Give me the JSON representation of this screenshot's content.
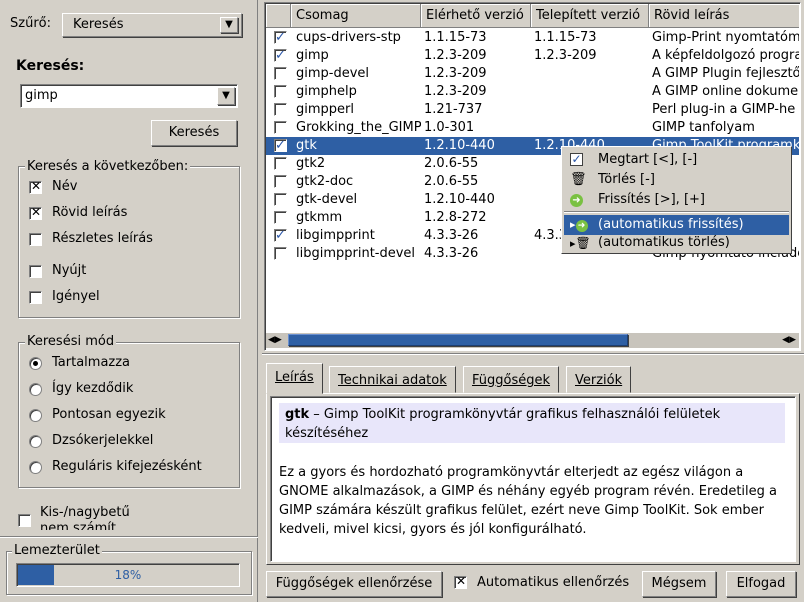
{
  "filter": {
    "label": "Szűrő:",
    "value": "Keresés"
  },
  "search": {
    "label": "Keresés:",
    "value": "gimp",
    "button": "Keresés"
  },
  "search_in": {
    "title": "Keresés a következőben:",
    "items": [
      {
        "label": "Név",
        "checked": true
      },
      {
        "label": "Rövid leírás",
        "checked": true
      },
      {
        "label": "Részletes leírás",
        "checked": false
      },
      {
        "label": "Nyújt",
        "checked": false
      },
      {
        "label": "Igényel",
        "checked": false
      }
    ]
  },
  "search_mode": {
    "title": "Keresési mód",
    "items": [
      {
        "label": "Tartalmazza",
        "selected": true
      },
      {
        "label": "Így kezdődik",
        "selected": false
      },
      {
        "label": "Pontosan egyezik",
        "selected": false
      },
      {
        "label": "Dzsókerjelekkel",
        "selected": false
      },
      {
        "label": "Reguláris kifejezésként",
        "selected": false
      }
    ]
  },
  "case_sensitive": {
    "label": "Kis-/nagybetű",
    "label2": "nem számít",
    "checked": false
  },
  "disk": {
    "title": "Lemezterület",
    "text": "18%",
    "fraction": 0.18
  },
  "table": {
    "columns": [
      "Csomag",
      "Elérhető verzió",
      "Telepített verzió",
      "Rövid leírás"
    ],
    "rows": [
      {
        "checked": true,
        "name": "cups-drivers-stp",
        "available": "1.1.15-73",
        "installed": "1.1.15-73",
        "desc": "Gimp-Print nyomtatóme"
      },
      {
        "checked": true,
        "name": "gimp",
        "available": "1.2.3-209",
        "installed": "1.2.3-209",
        "desc": "A képfeldolgozó progra"
      },
      {
        "checked": false,
        "name": "gimp-devel",
        "available": "1.2.3-209",
        "installed": "",
        "desc": "A GIMP Plugin fejlesztői"
      },
      {
        "checked": false,
        "name": "gimphelp",
        "available": "1.2.3-209",
        "installed": "",
        "desc": "A GIMP online dokumer"
      },
      {
        "checked": false,
        "name": "gimpperl",
        "available": "1.21-737",
        "installed": "",
        "desc": "Perl plug-in a GIMP-he"
      },
      {
        "checked": false,
        "name": "Grokking_the_GIMP",
        "available": "1.0-301",
        "installed": "",
        "desc": "GIMP tanfolyam"
      },
      {
        "checked": true,
        "name": "gtk",
        "available": "1.2.10-440",
        "installed": "1.2.10-440",
        "desc": "Gimp ToolKit programkö"
      },
      {
        "checked": false,
        "name": "gtk2",
        "available": "2.0.6-55",
        "installed": "",
        "desc": ""
      },
      {
        "checked": false,
        "name": "gtk2-doc",
        "available": "2.0.6-55",
        "installed": "",
        "desc": ""
      },
      {
        "checked": false,
        "name": "gtk-devel",
        "available": "1.2.10-440",
        "installed": "",
        "desc": ""
      },
      {
        "checked": false,
        "name": "gtkmm",
        "available": "1.2.8-272",
        "installed": "",
        "desc": ""
      },
      {
        "checked": true,
        "name": "libgimpprint",
        "available": "4.3.3-26",
        "installed": "4.3.3",
        "desc": ""
      },
      {
        "checked": false,
        "name": "libgimpprint-devel",
        "available": "4.3.3-26",
        "installed": "",
        "desc": "Gimp-nyomtató include"
      }
    ],
    "selected_index": 6
  },
  "context_menu": {
    "items": [
      {
        "label": "Megtart [<], [-]",
        "icon": "check-icon"
      },
      {
        "label": "Törlés [-]",
        "icon": "trash-icon"
      },
      {
        "label": "Frissítés [>], [+]",
        "icon": "update-icon"
      },
      {
        "label": "(automatikus frissítés)",
        "icon": "auto-update-icon"
      },
      {
        "label": "(automatikus törlés)",
        "icon": "auto-delete-icon"
      }
    ],
    "highlighted_index": 3
  },
  "tabs": [
    "Leírás",
    "Technikai adatok",
    "Függőségek",
    "Verziók"
  ],
  "description": {
    "name": "gtk",
    "summary": " – Gimp ToolKit programkönyvtár grafikus felhasználói felületek készítéséhez",
    "body": "Ez a gyors és hordozható programkönyvtár elterjedt az egész világon a GNOME alkalmazások, a GIMP és néhány egyéb program révén. Eredetileg a GIMP számára készült grafikus felület, ezért neve Gimp ToolKit. Sok ember kedveli, mivel kicsi, gyors és jól konfigurálható."
  },
  "bottom": {
    "check_deps": "Függőségek ellenőrzése",
    "auto_check": "Automatikus ellenőrzés",
    "auto_check_on": true,
    "cancel": "Mégsem",
    "accept": "Elfogad"
  }
}
